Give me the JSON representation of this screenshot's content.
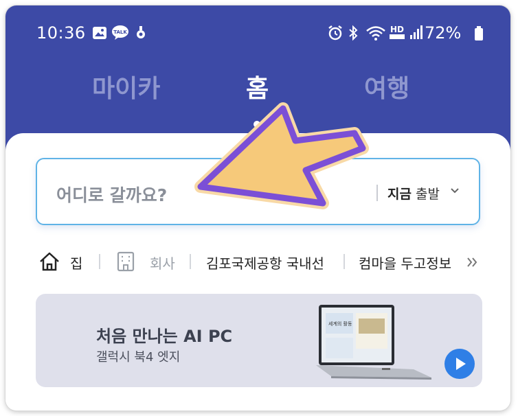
{
  "status_bar": {
    "time": "10:36",
    "badge_talk": "TALK",
    "battery_percent": "72%"
  },
  "top_tabs": [
    {
      "label": "마이카",
      "active": false
    },
    {
      "label": "홈",
      "active": true
    },
    {
      "label": "여행",
      "active": false
    }
  ],
  "search": {
    "placeholder": "어디로 갈까요?",
    "depart_bold": "지금",
    "depart_label": "출발"
  },
  "saved_places": [
    {
      "label": "집",
      "icon": "home-icon"
    },
    {
      "label": "회사",
      "icon": "building-icon"
    },
    {
      "label": "김포국제공항 국내선"
    },
    {
      "label": "컴마을 두고정보"
    }
  ],
  "banner": {
    "title": "처음 만나는 AI PC",
    "subtitle": "갤럭시 북4 엣지",
    "screen_text": "세계의 활동"
  },
  "colors": {
    "header_bg": "#3d4aa6",
    "accent_blue": "#2f7fe6",
    "search_border": "#5fb3e6",
    "annotation_arrow_fill": "#f6c97a",
    "annotation_arrow_stroke": "#7b4fd6"
  }
}
